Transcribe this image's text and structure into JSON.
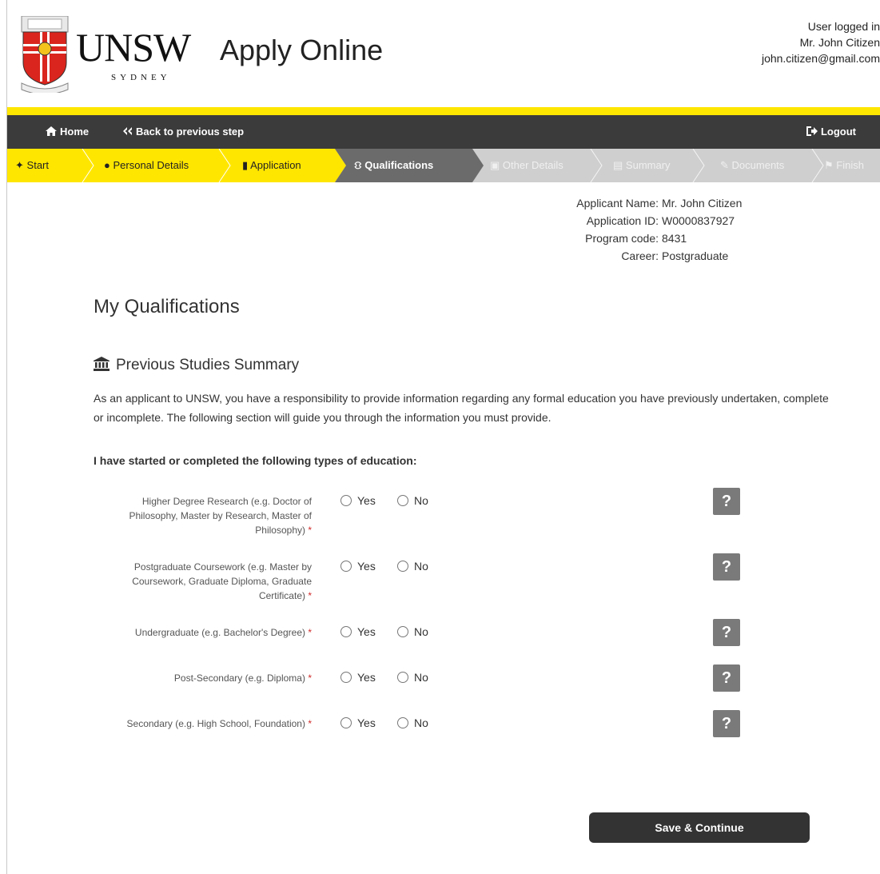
{
  "header": {
    "logo_main": "UNSW",
    "logo_sub": "SYDNEY",
    "app_title": "Apply Online",
    "user_status": "User logged in",
    "user_name": "Mr. John Citizen",
    "user_email": "john.citizen@gmail.com"
  },
  "nav": {
    "home": "Home",
    "back": "Back to previous step",
    "logout": "Logout"
  },
  "steps": [
    {
      "label": "Start",
      "icon": "home-icon",
      "state": "done"
    },
    {
      "label": "Personal Details",
      "icon": "user-icon",
      "state": "done"
    },
    {
      "label": "Application",
      "icon": "book-icon",
      "state": "done"
    },
    {
      "label": "Qualifications",
      "icon": "bank-icon",
      "state": "current"
    },
    {
      "label": "Other Details",
      "icon": "file-icon",
      "state": "future"
    },
    {
      "label": "Summary",
      "icon": "list-icon",
      "state": "future"
    },
    {
      "label": "Documents",
      "icon": "paperclip-icon",
      "state": "future"
    },
    {
      "label": "Finish",
      "icon": "flag-icon",
      "state": "future"
    }
  ],
  "applicant": {
    "name_label": "Applicant Name:",
    "name": "Mr. John Citizen",
    "id_label": "Application ID:",
    "id": "W0000837927",
    "program_label": "Program code:",
    "program": "8431",
    "career_label": "Career:",
    "career": "Postgraduate"
  },
  "page": {
    "title": "My Qualifications",
    "section_title": "Previous Studies Summary",
    "intro": "As an applicant to UNSW, you have a responsibility to provide information regarding any formal education you have previously undertaken, complete or incomplete. The following section will guide you through the information you must provide.",
    "prompt": "I have started or completed the following types of education:"
  },
  "questions": [
    {
      "label": "Higher Degree Research (e.g. Doctor of Philosophy, Master by Research, Master of Philosophy)",
      "yes": "Yes",
      "no": "No"
    },
    {
      "label": "Postgraduate Coursework (e.g. Master by Coursework, Graduate Diploma, Graduate Certificate)",
      "yes": "Yes",
      "no": "No"
    },
    {
      "label": "Undergraduate (e.g. Bachelor's Degree)",
      "yes": "Yes",
      "no": "No"
    },
    {
      "label": "Post-Secondary (e.g. Diploma)",
      "yes": "Yes",
      "no": "No"
    },
    {
      "label": "Secondary (e.g. High School, Foundation)",
      "yes": "Yes",
      "no": "No"
    }
  ],
  "required_mark": "*",
  "help_mark": "?",
  "save_button": "Save & Continue",
  "colors": {
    "brand_yellow": "#ffe600",
    "nav_dark": "#3b3b3b",
    "step_current": "#6b6b6b",
    "step_future": "#cfcfcf",
    "help_gray": "#7a7a7a",
    "required_red": "#d12a2a"
  }
}
